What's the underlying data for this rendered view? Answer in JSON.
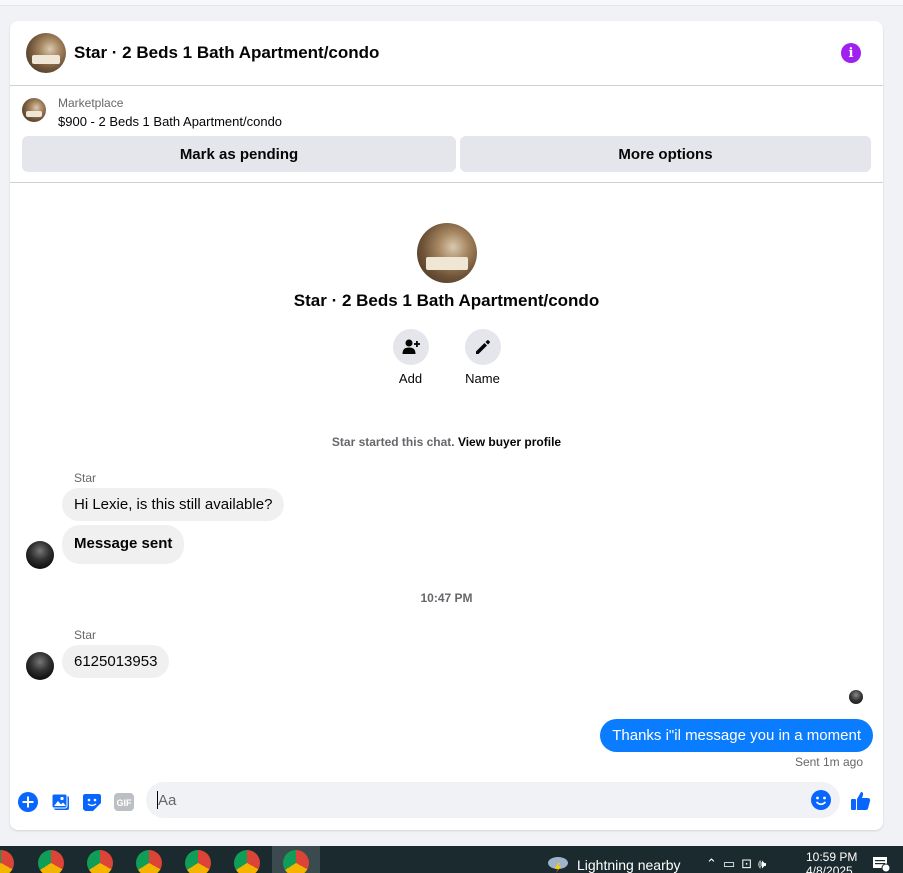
{
  "header": {
    "title": "Star · 2 Beds 1 Bath Apartment/condo",
    "info_icon": "info-icon",
    "accent": "#a020f0"
  },
  "listing": {
    "source": "Marketplace",
    "title": "$900 - 2 Beds 1 Bath Apartment/condo",
    "mark_pending_label": "Mark as pending",
    "more_options_label": "More options"
  },
  "profile": {
    "name": "Star · 2 Beds 1 Bath Apartment/condo",
    "actions": [
      {
        "label": "Add",
        "icon": "add-person-icon"
      },
      {
        "label": "Name",
        "icon": "pencil-icon"
      }
    ]
  },
  "chat": {
    "started_text": "Star started this chat.",
    "view_profile_link": "View buyer profile",
    "groups": [
      {
        "sender": "Star",
        "messages": [
          "Hi Lexie, is this still available?",
          "Message sent"
        ]
      },
      {
        "sender": "Star",
        "messages": [
          "6125013953"
        ]
      }
    ],
    "timestamp": "10:47 PM",
    "outgoing": {
      "text": "Thanks i\"il message you in a moment",
      "status": "Sent 1m ago",
      "color": "#0a7cff"
    }
  },
  "composer": {
    "placeholder": "Aa",
    "icons": [
      "plus-circle-icon",
      "photo-icon",
      "sticker-icon",
      "gif-icon",
      "emoji-icon",
      "thumbs-up-icon"
    ],
    "gif_label": "GIF"
  },
  "taskbar": {
    "weather": "Lightning nearby",
    "time": "10:59 PM",
    "date": "4/8/2025",
    "notification_count": "2"
  }
}
